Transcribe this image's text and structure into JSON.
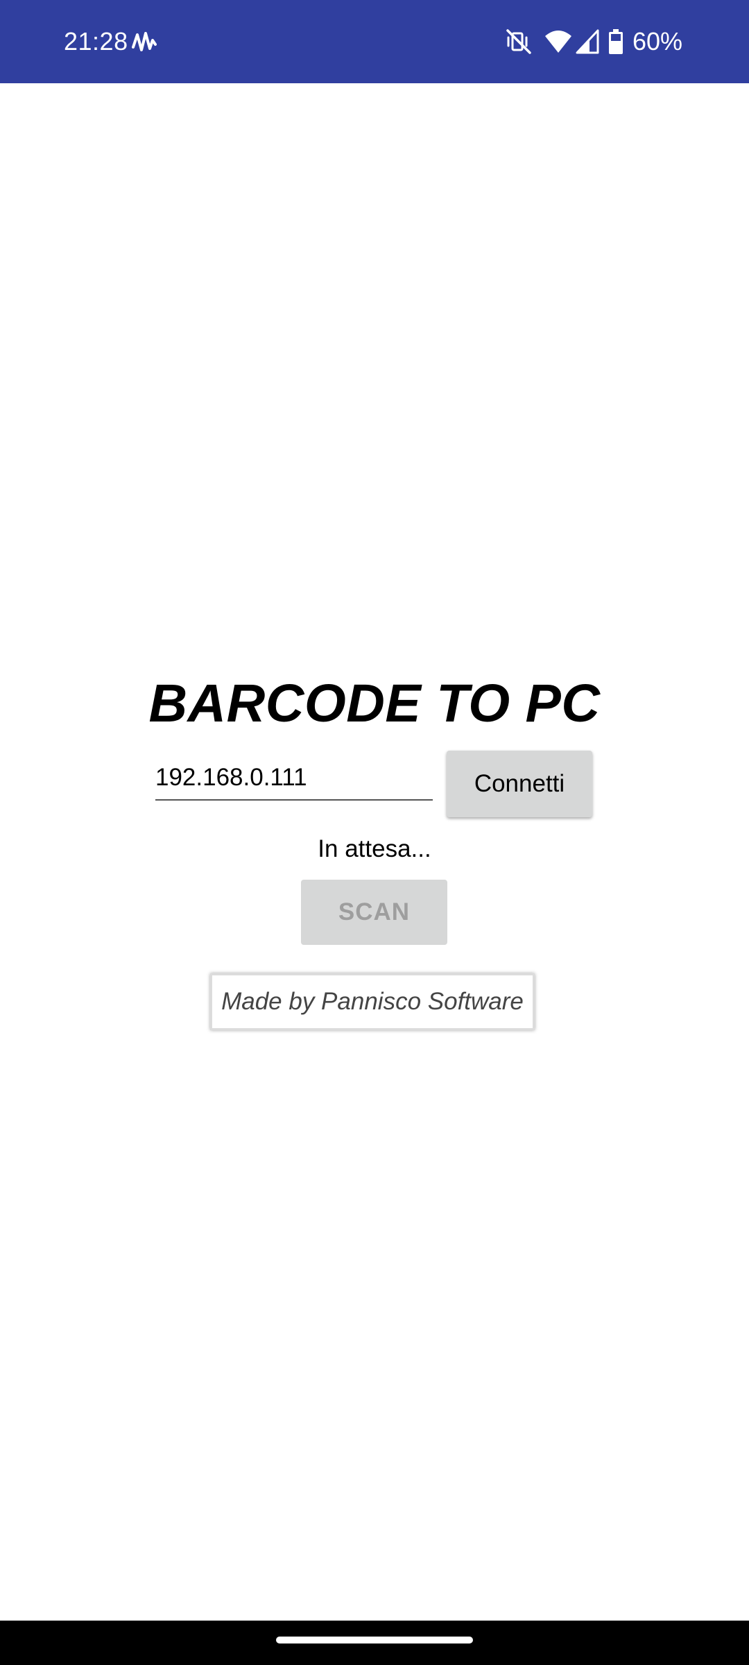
{
  "status_bar": {
    "time": "21:28",
    "battery_percent": "60%",
    "icons": [
      "waveform-icon",
      "vibrate-off-icon",
      "wifi-icon",
      "cellular-signal-icon",
      "battery-icon"
    ],
    "background_color": "#303f9f"
  },
  "app": {
    "title": "BARCODE TO PC",
    "ip_field": {
      "value": "192.168.0.111"
    },
    "connect_label": "Connetti",
    "status_text": "In attesa...",
    "scan_label": "SCAN",
    "scan_enabled": false,
    "credit": "Made by Pannisco Software"
  }
}
